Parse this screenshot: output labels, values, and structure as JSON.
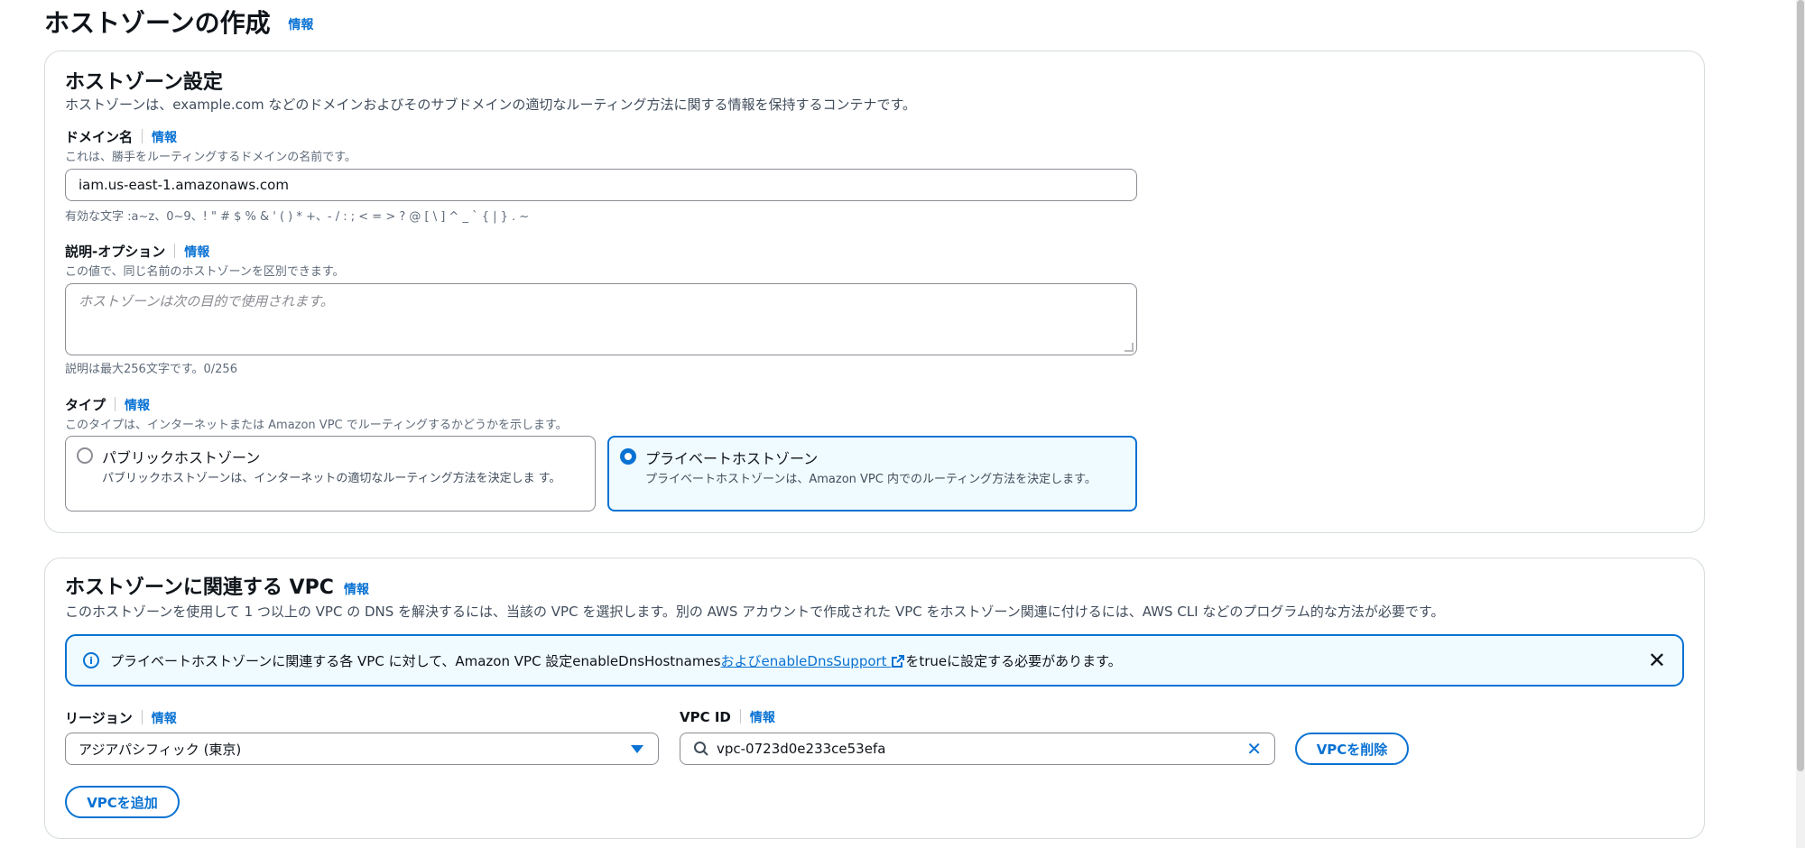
{
  "page": {
    "title": "ホストゾーンの作成",
    "info": "情報"
  },
  "settings": {
    "heading": "ホストゾーン設定",
    "description": "ホストゾーンは、example.com などのドメインおよびそのサブドメインの適切なルーティング方法に関する情報を保持するコンテナです。",
    "domain": {
      "label": "ドメイン名",
      "info": "情報",
      "hint": "これは、勝手をルーティングするドメインの名前です。",
      "value": "iam.us-east-1.amazonaws.com",
      "constraint": "有効な文字 :a~z、0~9、! \" # $ % & ' ( ) * +、- / : ; < = > ? @ [ \\ ] ^ _ ` { | } . ~"
    },
    "description_field": {
      "label": "説明-オプション",
      "info": "情報",
      "hint": "この値で、同じ名前のホストゾーンを区別できます。",
      "placeholder": "ホストゾーンは次の目的で使用されます。",
      "constraint": "説明は最大256文字です。0/256"
    },
    "type": {
      "label": "タイプ",
      "info": "情報",
      "hint": "このタイプは、インターネットまたは Amazon VPC でルーティングするかどうかを示します。",
      "options": [
        {
          "title": "パブリックホストゾーン",
          "desc": "パブリックホストゾーンは、インターネットの適切なルーティング方法を決定しま す。",
          "selected": false
        },
        {
          "title": "プライベートホストゾーン",
          "desc": "プライベートホストゾーンは、Amazon VPC 内でのルーティング方法を決定します。",
          "selected": true
        }
      ]
    }
  },
  "vpc": {
    "heading": "ホストゾーンに関連する VPC",
    "info": "情報",
    "description": "このホストゾーンを使用して 1 つ以上の VPC の DNS を解決するには、当該の VPC を選択します。別の AWS アカウントで作成された VPC をホストゾーン関連に付けるには、AWS CLI などのプログラム的な方法が必要です。",
    "alert": {
      "text_before": "プライベートホストゾーンに関連する各 VPC に対して、Amazon VPC 設定enableDnsHostnames",
      "link": "およびenableDnsSupport",
      "text_after": "をtrueに設定する必要があります。"
    },
    "region": {
      "label": "リージョン",
      "info": "情報",
      "value": "アジアパシフィック (東京)"
    },
    "vpc_id": {
      "label": "VPC ID",
      "info": "情報",
      "value": "vpc-0723d0e233ce53efa"
    },
    "remove_button": "VPCを削除",
    "add_button": "VPCを追加"
  },
  "colors": {
    "accent": "#0972d3",
    "alert_bg": "#f0fbff",
    "border": "#8c8c94"
  }
}
